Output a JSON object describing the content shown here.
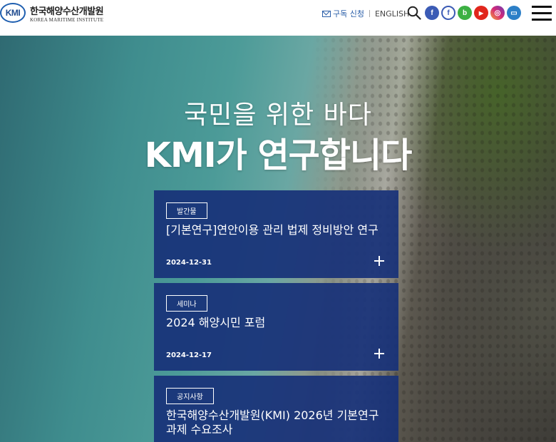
{
  "header": {
    "logo": {
      "badge": "KMI",
      "name_ko": "한국해양수산개발원",
      "name_en": "KOREA MARITIME INSTITUTE"
    },
    "subscribe_label": "구독 신청",
    "english_label": "ENGLISH",
    "social": [
      {
        "icon": "facebook-icon",
        "glyph": "f",
        "color": "#3b5bb5"
      },
      {
        "icon": "facebook-outline-icon",
        "glyph": "f",
        "color": "#3b5bb5"
      },
      {
        "icon": "blog-icon",
        "glyph": "b",
        "color": "#3cb043"
      },
      {
        "icon": "youtube-icon",
        "glyph": "▶",
        "color": "#e1261c"
      },
      {
        "icon": "instagram-icon",
        "glyph": "◎",
        "color": "#c13584"
      },
      {
        "icon": "book-icon",
        "glyph": "▭",
        "color": "#2c7fc7"
      }
    ]
  },
  "hero": {
    "line1": "국민을 위한 바다",
    "line2": "KMI가 연구합니다"
  },
  "cards": [
    {
      "badge": "발간물",
      "title": "[기본연구]연안이용 관리 법제 정비방안 연구",
      "date": "2024-12-31"
    },
    {
      "badge": "세미나",
      "title": "2024 해양시민 포럼",
      "date": "2024-12-17"
    },
    {
      "badge": "공지사항",
      "title": "한국해양수산개발원(KMI) 2026년 기본연구 과제 수요조사",
      "date": ""
    }
  ],
  "colors": {
    "accent": "#2a5ea8",
    "card_bg": "#183178"
  }
}
